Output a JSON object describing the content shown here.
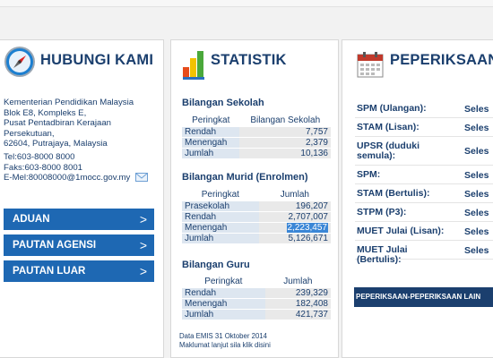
{
  "hubungi": {
    "title": "HUBUNGI KAMI",
    "address": [
      "Kementerian Pendidikan Malaysia",
      "Blok E8, Kompleks E,",
      "Pusat Pentadbiran Kerajaan",
      "Persekutuan,",
      "62604, Putrajaya, Malaysia"
    ],
    "tel": "Tel:603-8000 8000",
    "faks": "Faks:603-8000 8001",
    "email": "E-Mel:80008000@1mocc.gov.my",
    "buttons": [
      {
        "label": "ADUAN",
        "chevron": ">"
      },
      {
        "label": "PAUTAN AGENSI",
        "chevron": ">"
      },
      {
        "label": "PAUTAN LUAR",
        "chevron": ">"
      }
    ]
  },
  "statistik": {
    "title": "STATISTIK",
    "sekolah": {
      "heading": "Bilangan Sekolah",
      "col1": "Peringkat",
      "col2": "Bilangan Sekolah",
      "rows": [
        {
          "label": "Rendah",
          "value": "7,757"
        },
        {
          "label": "Menengah",
          "value": "2,379"
        },
        {
          "label": "Jumlah",
          "value": "10,136"
        }
      ]
    },
    "murid": {
      "heading": "Bilangan Murid (Enrolmen)",
      "col1": "Peringkat",
      "col2": "Jumlah",
      "rows": [
        {
          "label": "Prasekolah",
          "value": "196,207"
        },
        {
          "label": "Rendah",
          "value": "2,707,007"
        },
        {
          "label": "Menengah",
          "value": "2,223,457"
        },
        {
          "label": "Jumlah",
          "value": "5,126,671"
        }
      ]
    },
    "guru": {
      "heading": "Bilangan Guru",
      "col1": "Peringkat",
      "col2": "Jumlah",
      "rows": [
        {
          "label": "Rendah",
          "value": "239,329"
        },
        {
          "label": "Menengah",
          "value": "182,408"
        },
        {
          "label": "Jumlah",
          "value": "421,737"
        }
      ]
    },
    "note1": "Data EMIS 31 Oktober 2014",
    "note2": "Maklumat lanjut sila klik disini"
  },
  "peperiksaan": {
    "title": "PEPERIKSAAN",
    "items": [
      {
        "name": "SPM (Ulangan):",
        "status": "Seles"
      },
      {
        "name": "STAM (Lisan):",
        "status": "Seles"
      },
      {
        "name": "UPSR (duduki semula):",
        "status": "Seles"
      },
      {
        "name": "SPM:",
        "status": "Seles"
      },
      {
        "name": "STAM (Bertulis):",
        "status": "Seles"
      },
      {
        "name": "STPM (P3):",
        "status": "Seles"
      },
      {
        "name": "MUET Julai (Lisan):",
        "status": "Seles"
      },
      {
        "name": "MUET Julai (Bertulis):",
        "status": "Seles"
      }
    ],
    "more_button": "PEPERIKSAAN-PEPERIKSAAN LAIN"
  },
  "colors": {
    "navy": "#1b3f6e",
    "button_blue": "#1e68b3",
    "highlight": "#3a86d6"
  }
}
